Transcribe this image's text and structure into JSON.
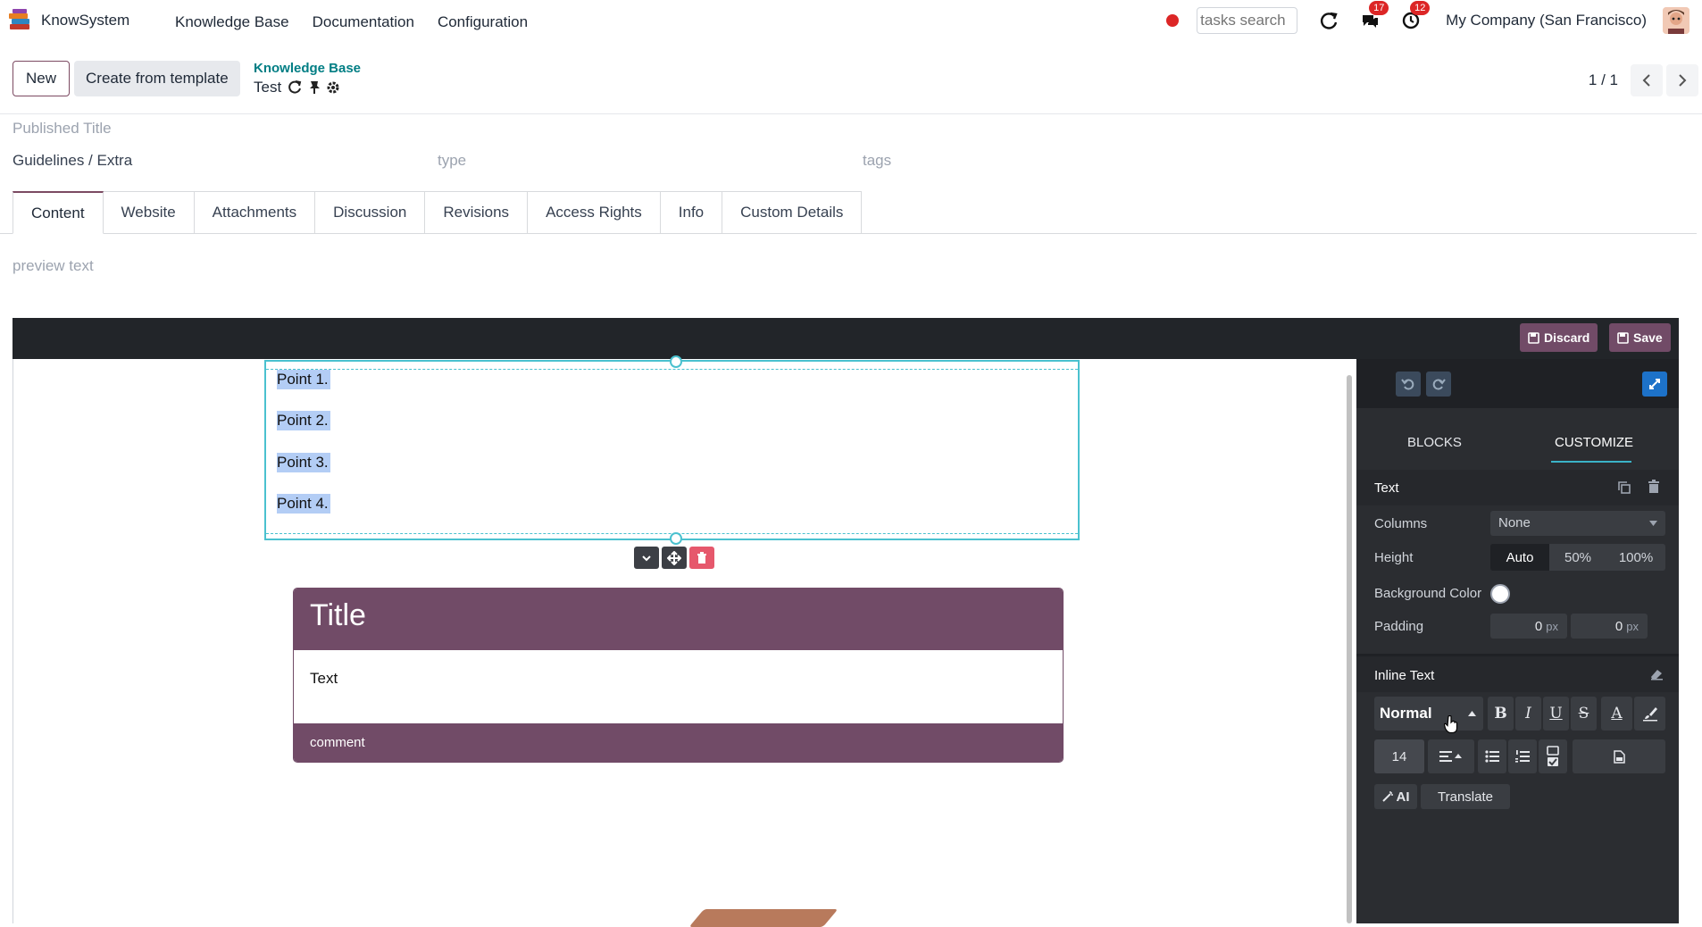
{
  "app": {
    "name": "KnowSystem"
  },
  "nav": {
    "menu": [
      "Knowledge Base",
      "Documentation",
      "Configuration"
    ],
    "search_placeholder": "tasks search",
    "chat_badge": "17",
    "activity_badge": "12",
    "company": "My Company (San Francisco)"
  },
  "control_panel": {
    "new_label": "New",
    "template_label": "Create from template",
    "breadcrumb": "Knowledge Base",
    "record_name": "Test",
    "pager": "1 / 1"
  },
  "form": {
    "published_title_placeholder": "Published Title",
    "path": "Guidelines / Extra",
    "type_placeholder": "type",
    "tags_placeholder": "tags",
    "tabs": [
      "Content",
      "Website",
      "Attachments",
      "Discussion",
      "Revisions",
      "Access Rights",
      "Info",
      "Custom Details"
    ],
    "preview_placeholder": "preview text"
  },
  "editor": {
    "discard_label": "Discard",
    "save_label": "Save",
    "points": [
      "Point 1.",
      "Point 2.",
      "Point 3.",
      "Point 4."
    ],
    "card": {
      "title": "Title",
      "text": "Text",
      "comment": "comment"
    },
    "colors": {
      "accent": "#714b67",
      "selection": "#4ac1cf",
      "highlight": "#b3cdf5"
    }
  },
  "panel": {
    "tab_blocks": "BLOCKS",
    "tab_customize": "CUSTOMIZE",
    "text_section": "Text",
    "columns_label": "Columns",
    "columns_value": "None",
    "height_label": "Height",
    "height_options": [
      "Auto",
      "50%",
      "100%"
    ],
    "height_selected": "Auto",
    "bg_color_label": "Background Color",
    "padding_label": "Padding",
    "padding_values": [
      "0",
      "0"
    ],
    "padding_unit": "px",
    "inline_text_section": "Inline Text",
    "style_value": "Normal",
    "font_size": "14",
    "ai_label": "AI",
    "translate_label": "Translate",
    "format_buttons": [
      "B",
      "I",
      "U",
      "S",
      "A"
    ]
  }
}
